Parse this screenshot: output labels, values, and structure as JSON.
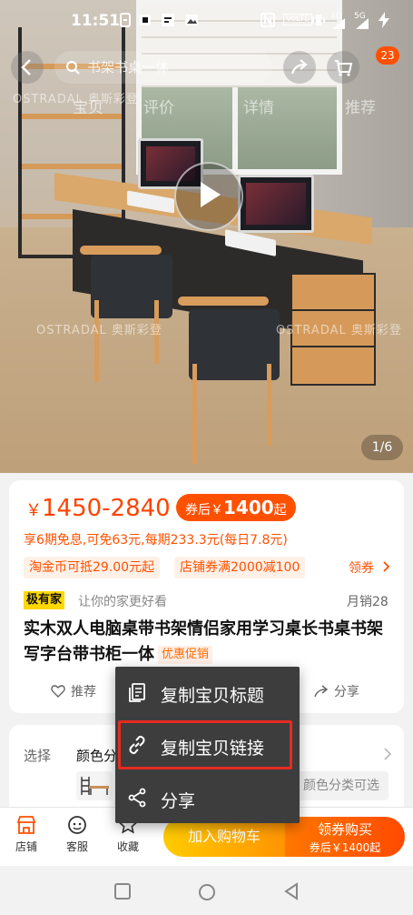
{
  "status_bar": {
    "time": "11:51",
    "icons": [
      "sim-icon",
      "msg-icon",
      "notification-icon",
      "gallery-icon",
      "nfc-icon",
      "volte-icon",
      "vibrate-icon",
      "4g-signal-icon",
      "5g-signal-icon",
      "charging-icon"
    ],
    "volte_text": "VoLTE",
    "signal1_text": "4G",
    "signal2_text": "5G"
  },
  "hero": {
    "search_text": "书架书桌一体",
    "tabs": [
      "宝贝",
      "评价",
      "详情",
      "推荐"
    ],
    "cart_badge": "23",
    "image_counter": "1/6",
    "watermark": "OSTRADAL 奥斯彩登"
  },
  "price": {
    "currency": "￥",
    "range": "1450-2840",
    "coupon_label": "券后",
    "coupon_currency": "￥",
    "coupon_value": "1400",
    "coupon_suffix": "起",
    "installment": "享6期免息,可免63元,每期233.3元(每日7.8元)",
    "chips": [
      "淘金币可抵29.00元起",
      "店铺券满2000减100"
    ],
    "get_coupon": "领券"
  },
  "product": {
    "brand_tag": "极有家",
    "slogan": "让你的家更好看",
    "monthly_sales": "月销28",
    "title": "实木双人电脑桌带书架情侣家用学习桌长书桌书架写字台带书柜一体",
    "promo_tag": "优惠促销",
    "recommend": "推荐",
    "share": "分享"
  },
  "selection": {
    "label": "选择",
    "value": "颜色分类",
    "variant_hint": "颜色分类可选"
  },
  "bottom_bar": {
    "shop": "店铺",
    "service": "客服",
    "favorite": "收藏",
    "add_to_cart": "加入购物车",
    "buy_now": "领券购买",
    "buy_sub": "券后￥1400起"
  },
  "context_menu": {
    "items": [
      {
        "label": "复制宝贝标题",
        "icon": "copy-document-icon"
      },
      {
        "label": "复制宝贝链接",
        "icon": "link-icon"
      },
      {
        "label": "分享",
        "icon": "share-icon"
      }
    ]
  },
  "colors": {
    "accent": "#ff5000",
    "price": "#ff4400",
    "cart_gradient": [
      "#ffcb00",
      "#ff9402"
    ],
    "buy_gradient": [
      "#ff7700",
      "#ff4a00"
    ],
    "menu_bg": "#3d3d3d",
    "highlight": "#e52b20"
  }
}
